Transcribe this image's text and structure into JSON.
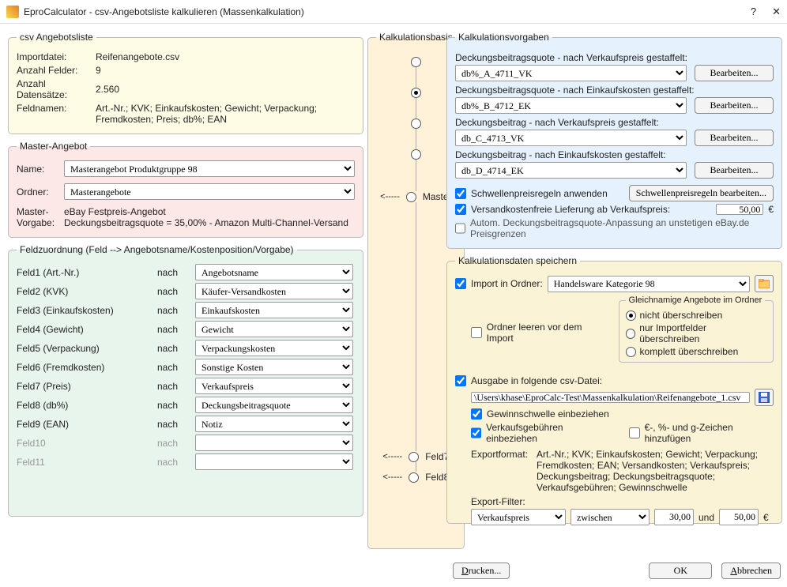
{
  "window": {
    "title": "EproCalculator - csv-Angebotsliste kalkulieren (Massenkalkulation)",
    "help": "?",
    "close": "✕"
  },
  "csv": {
    "legend": "csv Angebotsliste",
    "l_import": "Importdatei:",
    "importdatei": "Reifenangebote.csv",
    "l_anzf": "Anzahl Felder:",
    "anzf": "9",
    "l_anzd": "Anzahl Datensätze:",
    "anzd": "2.560",
    "l_feld": "Feldnamen:",
    "feldnamen": "Art.-Nr.; KVK; Einkaufskosten; Gewicht; Verpackung; Fremdkosten; Preis; db%; EAN"
  },
  "master": {
    "legend": "Master-Angebot",
    "l_name": "Name:",
    "name": "Masterangebot Produktgruppe 98",
    "l_ordner": "Ordner:",
    "ordner": "Masterangebote",
    "l_mv": "Master- Vorgabe:",
    "mv": "eBay Festpreis-Angebot\nDeckungsbeitragsquote = 35,00%  -  Amazon Multi-Channel-Versand"
  },
  "fz": {
    "legend": "Feldzuordnung (Feld --> Angebotsname/Kostenposition/Vorgabe)",
    "nach": "nach",
    "f": [
      "Feld1 (Art.-Nr.)",
      "Feld2 (KVK)",
      "Feld3 (Einkaufskosten)",
      "Feld4 (Gewicht)",
      "Feld5 (Verpackung)",
      "Feld6 (Fremdkosten)",
      "Feld7 (Preis)",
      "Feld8 (db%)",
      "Feld9 (EAN)",
      "Feld10",
      "Feld11"
    ],
    "t": [
      "Angebotsname",
      "Käufer-Versandkosten",
      "Einkaufskosten",
      "Gewicht",
      "Verpackungskosten",
      "Sonstige Kosten",
      "Verkaufspreis",
      "Deckungsbeitragsquote",
      "Notiz",
      "",
      ""
    ]
  },
  "kb": {
    "legend": "Kalkulationsbasis",
    "master": "Master",
    "f7": "Feld7",
    "f8": "Feld8"
  },
  "kv": {
    "legend": "Kalkulationsvorgaben",
    "l1": "Deckungsbeitragsquote - nach Verkaufspreis gestaffelt:",
    "s1": "db%_A_4711_VK",
    "l2": "Deckungsbeitragsquote - nach Einkaufskosten gestaffelt:",
    "s2": "db%_B_4712_EK",
    "l3": "Deckungsbeitrag - nach Verkaufspreis gestaffelt:",
    "s3": "db_C_4713_VK",
    "l4": "Deckungsbeitrag - nach Einkaufskosten gestaffelt:",
    "s4": "db_D_4714_EK",
    "edit": "Bearbeiten...",
    "c1": "Schwellenpreisregeln anwenden",
    "b_sp": "Schwellenpreisregeln bearbeiten...",
    "c2": "Versandkostenfreie Lieferung ab Verkaufspreis:",
    "v_preis": "50,00",
    "eur": "€",
    "c3": "Autom. Deckungsbeitragsquote-Anpassung an unstetigen eBay.de Preisgrenzen"
  },
  "kd": {
    "legend": "Kalkulationsdaten speichern",
    "c1": "Import in Ordner:",
    "folder": "Handelsware Kategorie 98",
    "c2": "Ordner leeren vor dem Import",
    "gbox": "Gleichnamige Angebote im Ordner",
    "r1": "nicht überschreiben",
    "r2": "nur Importfelder überschreiben",
    "r3": "komplett überschreiben",
    "c3": "Ausgabe in folgende csv-Datei:",
    "path": "\\Users\\khase\\EproCalc-Test\\Massenkalkulation\\Reifenangebote_1.csv",
    "c4": "Gewinnschwelle einbeziehen",
    "c5": "Verkaufsgebühren einbeziehen",
    "c6": "€-, %- und g-Zeichen hinzufügen",
    "l_ef": "Exportformat:",
    "ef": "Art.-Nr.; KVK; Einkaufskosten; Gewicht; Verpackung; Fremdkosten; EAN; Versandkosten; Verkaufspreis; Deckungsbeitrag; Deckungsbeitragsquote; Verkaufsgebühren; Gewinnschwelle",
    "l_flt": "Export-Filter:",
    "flt1": "Verkaufspreis",
    "flt2": "zwischen",
    "v1": "30,00",
    "und": "und",
    "v2": "50,00"
  },
  "footer": {
    "print": "Drucken...",
    "ok": "OK",
    "cancel": "Abbrechen"
  }
}
